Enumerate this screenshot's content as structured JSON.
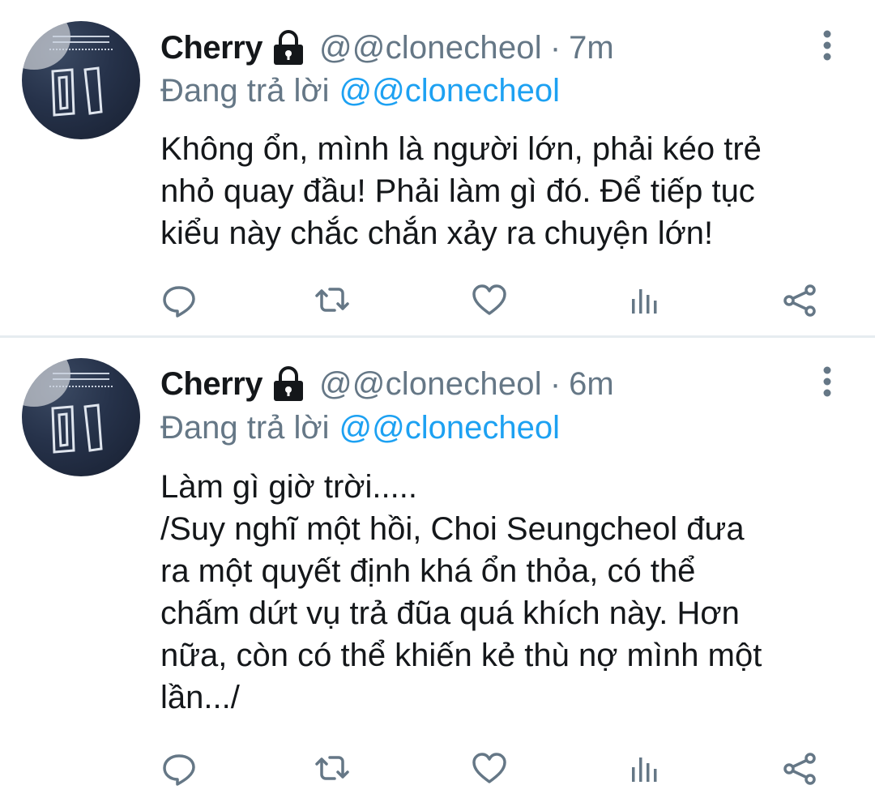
{
  "tweets": [
    {
      "author_name": "Cherry",
      "handle": "@@clonecheol",
      "separator": "·",
      "time": "7m",
      "reply_prefix": "Đang trả lời",
      "reply_handle": "@@clonecheol",
      "text": "Không ổn, mình là người lớn, phải kéo trẻ\nnhỏ quay đầu! Phải làm gì đó. Để tiếp tục\nkiểu này chắc chắn xảy ra chuyện lớn!"
    },
    {
      "author_name": "Cherry",
      "handle": "@@clonecheol",
      "separator": "·",
      "time": "6m",
      "reply_prefix": "Đang trả lời",
      "reply_handle": "@@clonecheol",
      "text": "Làm gì giờ trời.....\n/Suy nghĩ một hồi, Choi Seungcheol đưa\nra một quyết định khá ổn thỏa, có thể\nchấm dứt vụ trả đũa quá khích này. Hơn\nnữa, còn có thể khiến kẻ thù nợ mình một\nlần.../"
    }
  ],
  "icons": {
    "protected": "lock-icon",
    "more": "more-vertical-icon",
    "reply": "reply-bubble-icon",
    "retweet": "retweet-icon",
    "like": "heart-icon",
    "analytics": "analytics-bars-icon",
    "share": "share-icon"
  },
  "colors": {
    "accent": "#1da1f2",
    "secondary_text": "#657786",
    "primary_text": "#14171a",
    "divider": "#e6ecf0"
  }
}
